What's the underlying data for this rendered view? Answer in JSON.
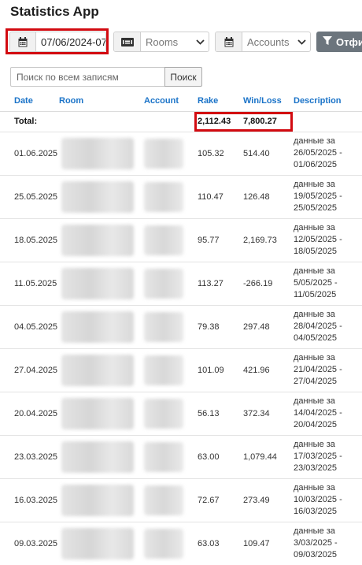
{
  "app": {
    "title": "Statistics App"
  },
  "filters": {
    "date_value": "07/06/2024-07",
    "date_icon": "calendar-icon",
    "rooms_placeholder": "Rooms",
    "rooms_icon": "money-icon",
    "accounts_placeholder": "Accounts",
    "accounts_icon": "calendar-icon",
    "filter_button_label": "Отфил",
    "filter_button_icon": "funnel-icon"
  },
  "search": {
    "placeholder": "Поиск по всем записям",
    "button_label": "Поиск"
  },
  "table": {
    "headers": {
      "date": "Date",
      "room": "Room",
      "account": "Account",
      "rake": "Rake",
      "winloss": "Win/Loss",
      "description": "Description"
    },
    "total": {
      "label": "Total:",
      "rake": "2,112.43",
      "winloss": "7,800.27"
    },
    "rows": [
      {
        "date": "01.06.2025",
        "rake": "105.32",
        "winloss": "514.40",
        "desc": [
          "данные за",
          "26/05/2025 -",
          "01/06/2025"
        ]
      },
      {
        "date": "25.05.2025",
        "rake": "110.47",
        "winloss": "126.48",
        "desc": [
          "данные за",
          "19/05/2025 -",
          "25/05/2025"
        ]
      },
      {
        "date": "18.05.2025",
        "rake": "95.77",
        "winloss": "2,169.73",
        "desc": [
          "данные за",
          "12/05/2025 -",
          "18/05/2025"
        ]
      },
      {
        "date": "11.05.2025",
        "rake": "113.27",
        "winloss": "-266.19",
        "desc": [
          "данные за",
          "5/05/2025 -",
          "11/05/2025"
        ]
      },
      {
        "date": "04.05.2025",
        "rake": "79.38",
        "winloss": "297.48",
        "desc": [
          "данные за",
          "28/04/2025 -",
          "04/05/2025"
        ]
      },
      {
        "date": "27.04.2025",
        "rake": "101.09",
        "winloss": "421.96",
        "desc": [
          "данные за",
          "21/04/2025 -",
          "27/04/2025"
        ]
      },
      {
        "date": "20.04.2025",
        "rake": "56.13",
        "winloss": "372.34",
        "desc": [
          "данные за",
          "14/04/2025 -",
          "20/04/2025"
        ]
      },
      {
        "date": "23.03.2025",
        "rake": "63.00",
        "winloss": "1,079.44",
        "desc": [
          "данные за",
          "17/03/2025 -",
          "23/03/2025"
        ]
      },
      {
        "date": "16.03.2025",
        "rake": "72.67",
        "winloss": "273.49",
        "desc": [
          "данные за",
          "10/03/2025 -",
          "16/03/2025"
        ]
      },
      {
        "date": "09.03.2025",
        "rake": "63.03",
        "winloss": "109.47",
        "desc": [
          "данные за",
          "3/03/2025 -",
          "09/03/2025"
        ]
      }
    ]
  },
  "colors": {
    "header_link": "#1a73c8",
    "highlight": "#d20a10",
    "filter_button_bg": "#6c757d"
  }
}
